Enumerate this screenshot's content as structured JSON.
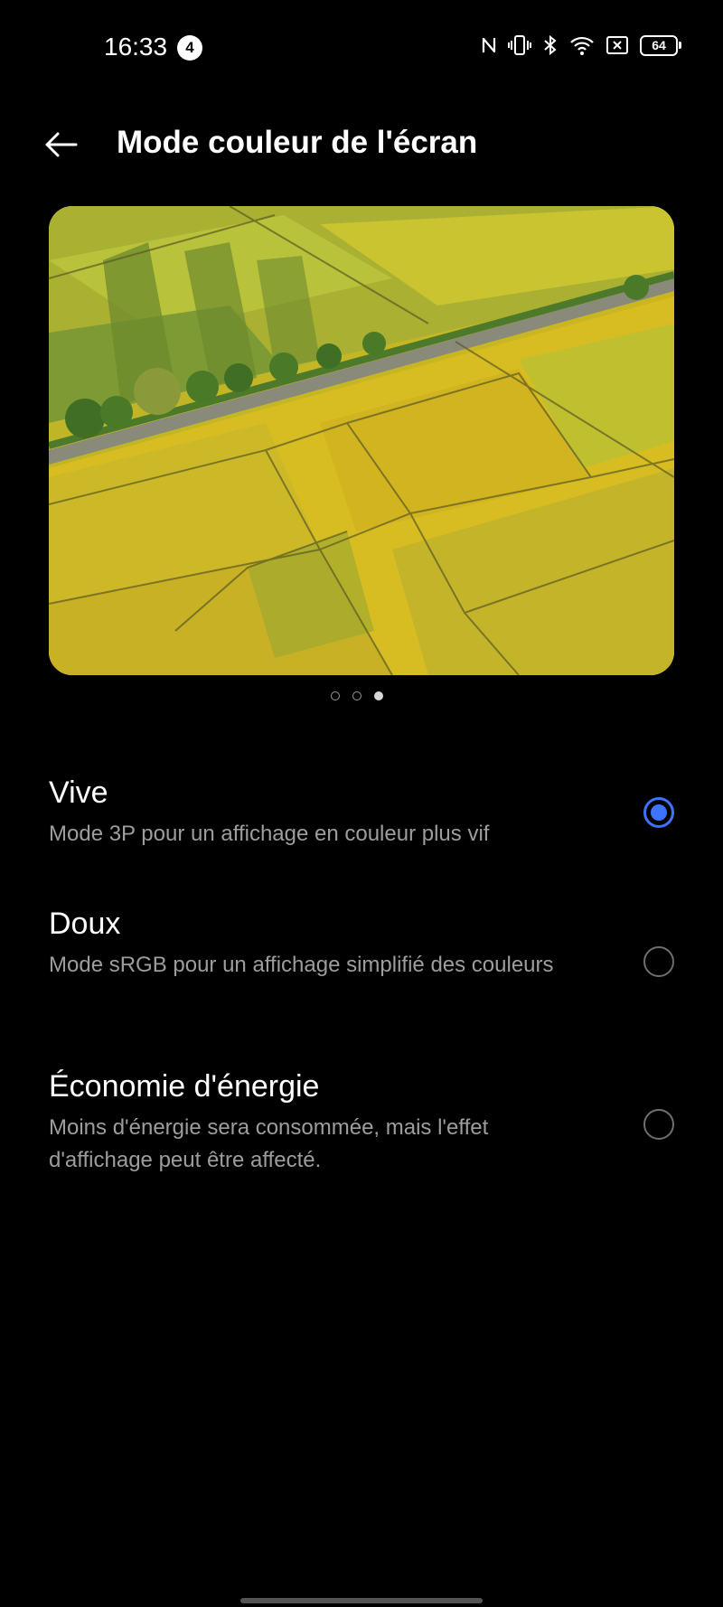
{
  "status_bar": {
    "time": "16:33",
    "notification_count": "4",
    "battery": "64",
    "icons": [
      "nfc-icon",
      "vibrate-icon",
      "bluetooth-icon",
      "wifi-icon",
      "sim-off-icon",
      "battery-icon"
    ]
  },
  "header": {
    "title": "Mode couleur de l'écran",
    "back_icon": "back-arrow-icon"
  },
  "preview": {
    "image": "aerial rice fields",
    "page_count": 3,
    "active_index": 2
  },
  "options": [
    {
      "title": "Vive",
      "description": "Mode 3P pour un affichage en couleur plus vif",
      "selected": true
    },
    {
      "title": "Doux",
      "description": "Mode sRGB pour un affichage simplifié des couleurs",
      "selected": false
    },
    {
      "title": "Économie d'énergie",
      "description": "Moins d'énergie sera consommée, mais l'effet d'affichage peut être affecté.",
      "selected": false
    }
  ],
  "colors": {
    "background": "#000000",
    "accent": "#3d73ff",
    "secondary_text": "#9d9d9d"
  }
}
